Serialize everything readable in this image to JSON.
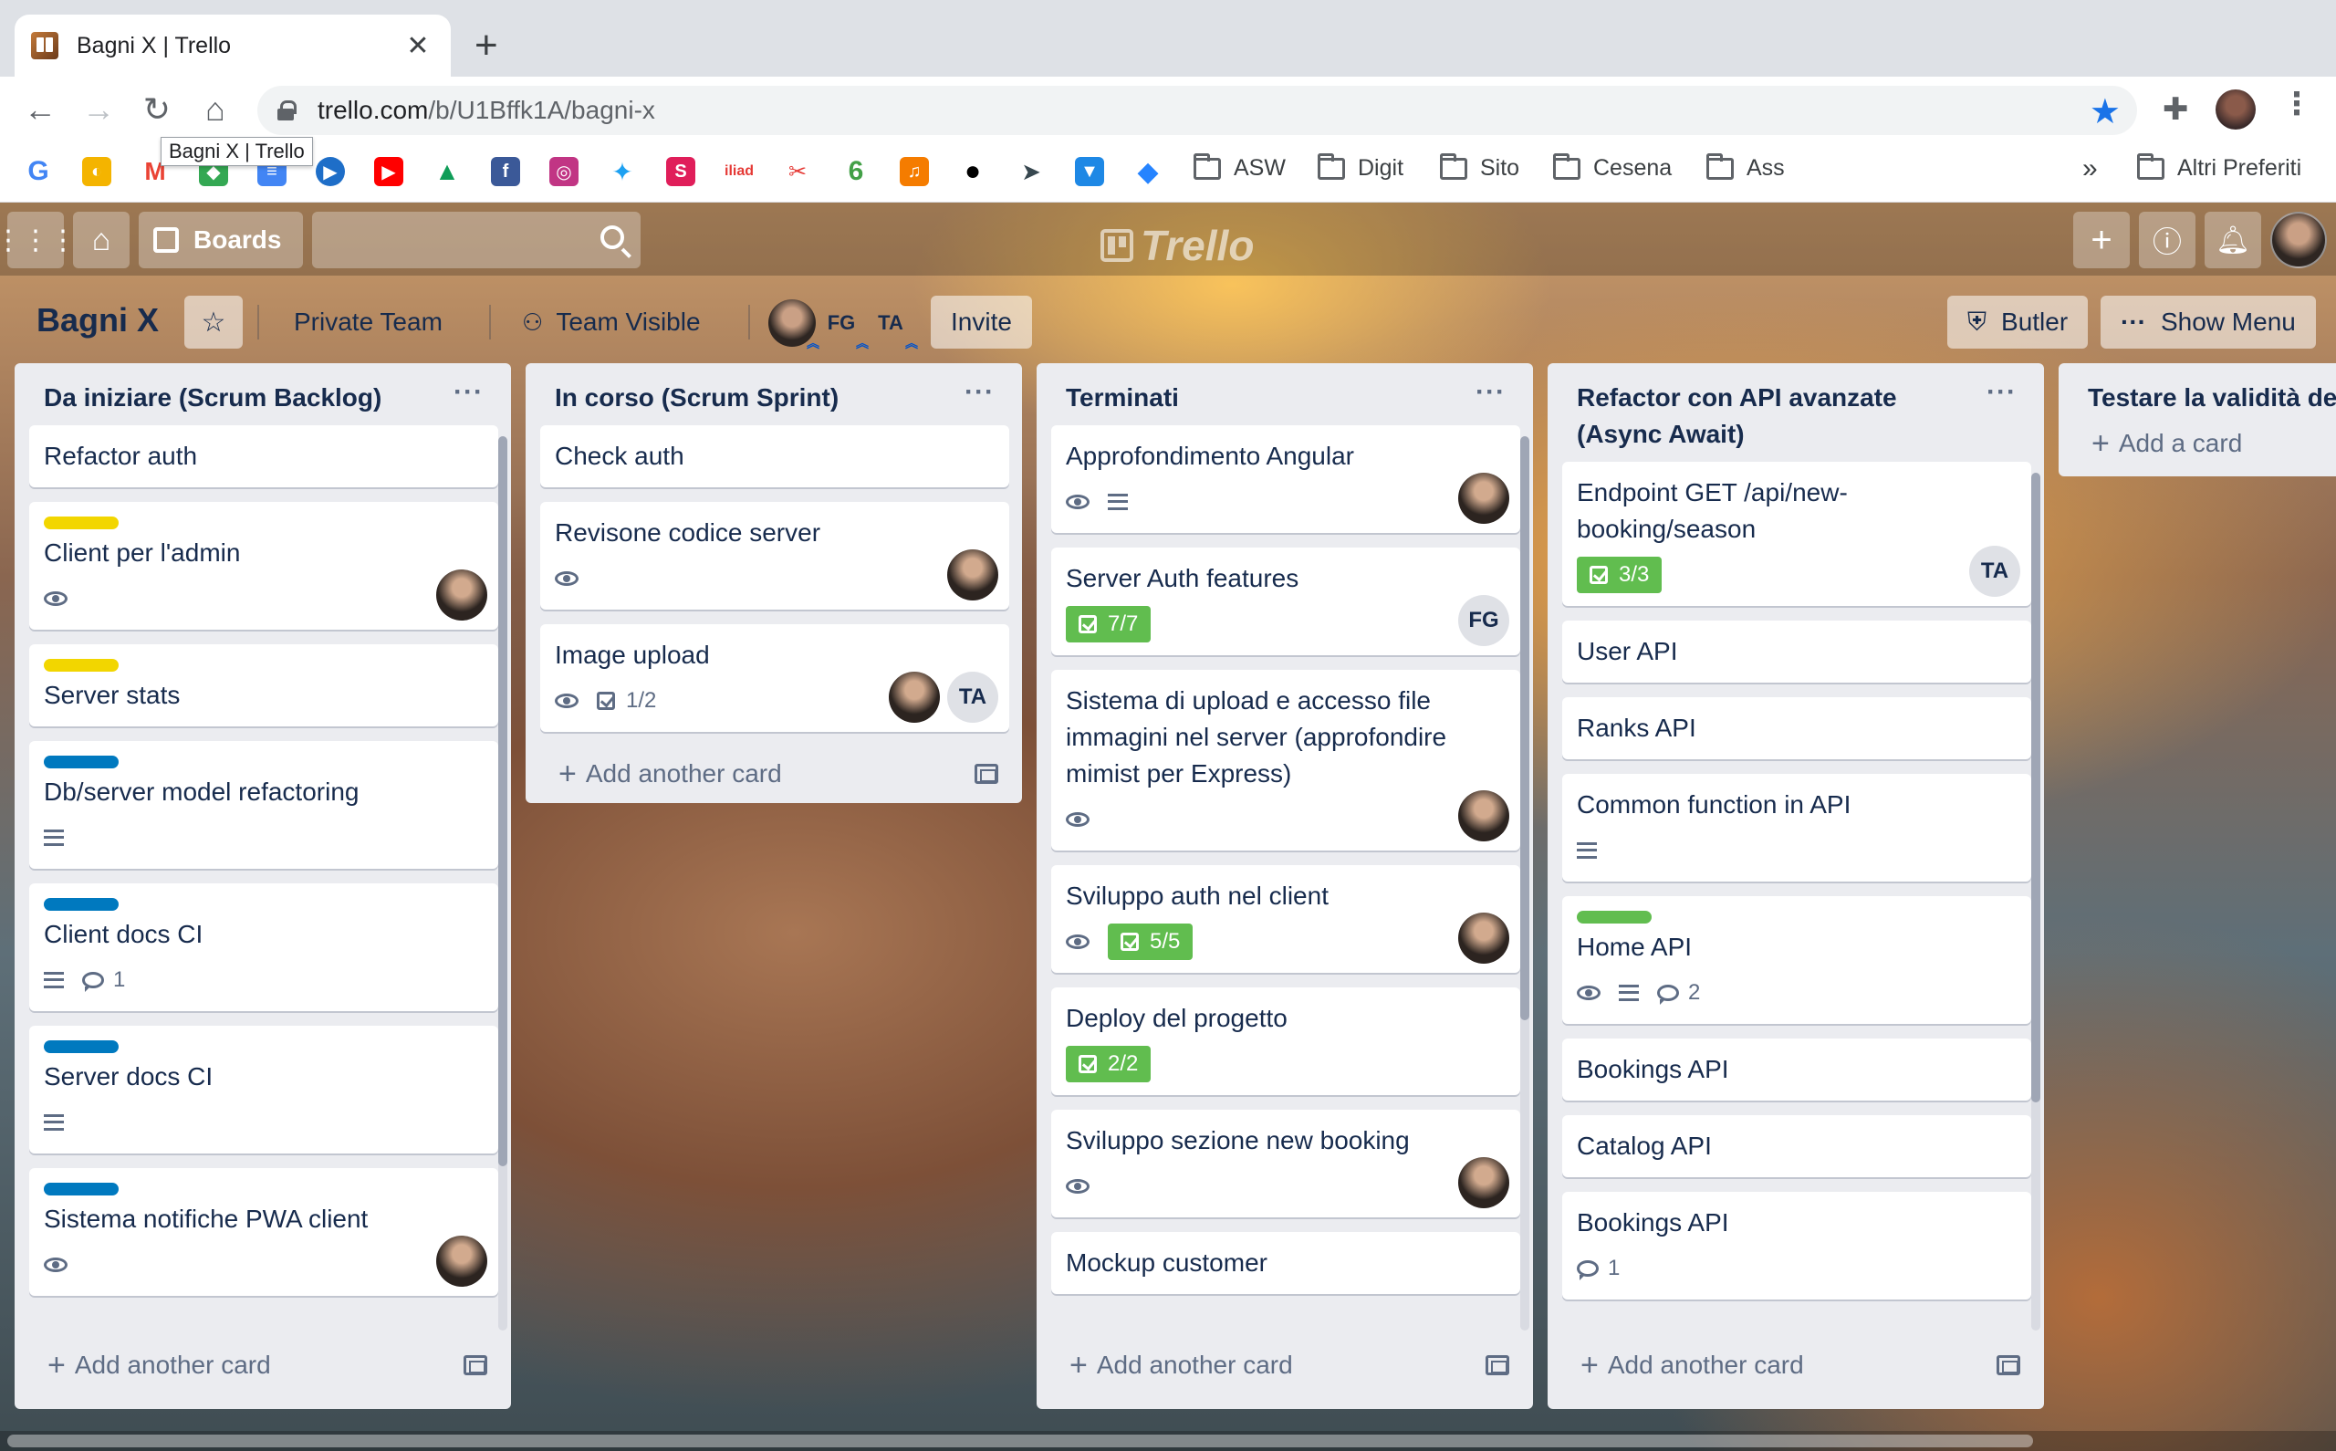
{
  "browser": {
    "tab_title": "Bagni X | Trello",
    "tooltip": "Bagni X | Trello",
    "url_host": "trello.com",
    "url_path": "/b/U1Bffk1A/bagni-x",
    "bookmark_folders": [
      "ASW",
      "Digit",
      "Sito",
      "Cesena",
      "Ass"
    ],
    "other_bookmarks": "Altri Preferiti",
    "overflow": "»"
  },
  "header": {
    "boards_label": "Boards",
    "logo": "Trello"
  },
  "board": {
    "title": "Bagni X",
    "team": "Private Team",
    "visibility": "Team Visible",
    "members": [
      "FG",
      "TA"
    ],
    "invite": "Invite",
    "butler": "Butler",
    "show_menu": "Show Menu"
  },
  "lists": [
    {
      "title": "Da iniziare (Scrum Backlog)",
      "footer": "Add another card",
      "cards": [
        {
          "title": "Refactor auth"
        },
        {
          "title": "Client per l'admin",
          "label": "#f2d600",
          "watch": true,
          "avatar": "photo"
        },
        {
          "title": "Server stats",
          "label": "#f2d600"
        },
        {
          "title": "Db/server model refactoring",
          "label": "#0079bf",
          "desc": true
        },
        {
          "title": "Client docs CI",
          "label": "#0079bf",
          "desc": true,
          "comments": "1"
        },
        {
          "title": "Server docs CI",
          "label": "#0079bf",
          "desc": true
        },
        {
          "title": "Sistema notifiche PWA client",
          "label": "#0079bf",
          "watch": true,
          "avatar": "photo"
        }
      ]
    },
    {
      "title": "In corso (Scrum Sprint)",
      "footer": "Add another card",
      "cards": [
        {
          "title": "Check auth"
        },
        {
          "title": "Revisone codice server",
          "watch": true,
          "avatar": "photo"
        },
        {
          "title": "Image upload",
          "watch": true,
          "checklist": "1/2",
          "avatar": "photo",
          "avatar2": "TA"
        }
      ]
    },
    {
      "title": "Terminati",
      "footer": "Add another card",
      "cards": [
        {
          "title": "Approfondimento Angular",
          "watch": true,
          "desc": true,
          "avatar": "photo"
        },
        {
          "title": "Server Auth features",
          "checklist_done": "7/7",
          "avatar_text": "FG"
        },
        {
          "title": "Sistema di upload e accesso file immagini nel server (approfondire mimist per Express)",
          "watch": true,
          "avatar": "photo"
        },
        {
          "title": "Sviluppo auth nel client",
          "watch": true,
          "checklist_done": "5/5",
          "avatar": "photo"
        },
        {
          "title": "Deploy del progetto",
          "checklist_done": "2/2"
        },
        {
          "title": "Sviluppo sezione new booking",
          "watch": true,
          "avatar": "photo"
        },
        {
          "title": "Mockup customer"
        }
      ]
    },
    {
      "title": "Refactor con API avanzate (Async Await)",
      "footer": "Add another card",
      "cards": [
        {
          "title": "Endpoint GET /api/new-booking/season",
          "checklist_done": "3/3",
          "avatar_text": "TA"
        },
        {
          "title": "User API"
        },
        {
          "title": "Ranks API"
        },
        {
          "title": "Common function in API",
          "desc": true
        },
        {
          "title": "Home API",
          "label": "#61bd4f",
          "watch": true,
          "desc": true,
          "comments": "2"
        },
        {
          "title": "Bookings API"
        },
        {
          "title": "Catalog API"
        },
        {
          "title": "Bookings API",
          "comments": "1"
        }
      ]
    },
    {
      "title": "Testare la validità de",
      "footer": "Add a card",
      "cards": []
    }
  ]
}
